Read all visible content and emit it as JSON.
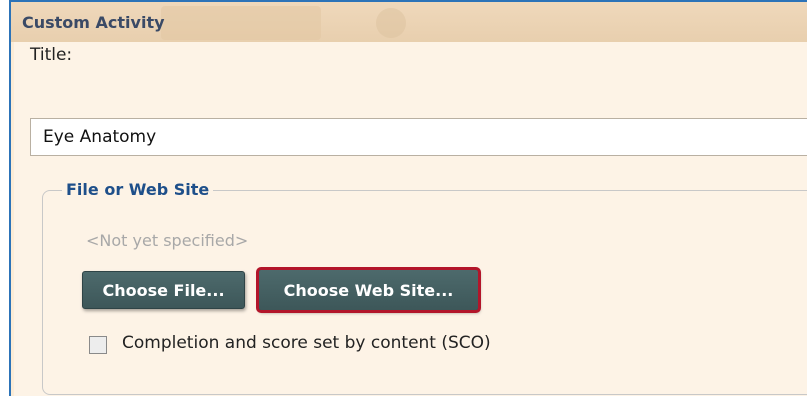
{
  "window": {
    "title": "Custom Activity"
  },
  "form": {
    "title_label": "Title:",
    "title_value": "Eye Anatomy"
  },
  "file_group": {
    "legend": "File or Web Site",
    "status_text": "<Not yet specified>",
    "choose_file_label": "Choose File...",
    "choose_web_site_label": "Choose Web Site...",
    "sco_checkbox_label": "Completion and score set by content (SCO)",
    "sco_checked": false
  },
  "colors": {
    "frame_border": "#2c73b8",
    "highlight_border": "#b3152a",
    "button_bg": "#4d6a6c",
    "legend_text": "#1e4f8a"
  }
}
